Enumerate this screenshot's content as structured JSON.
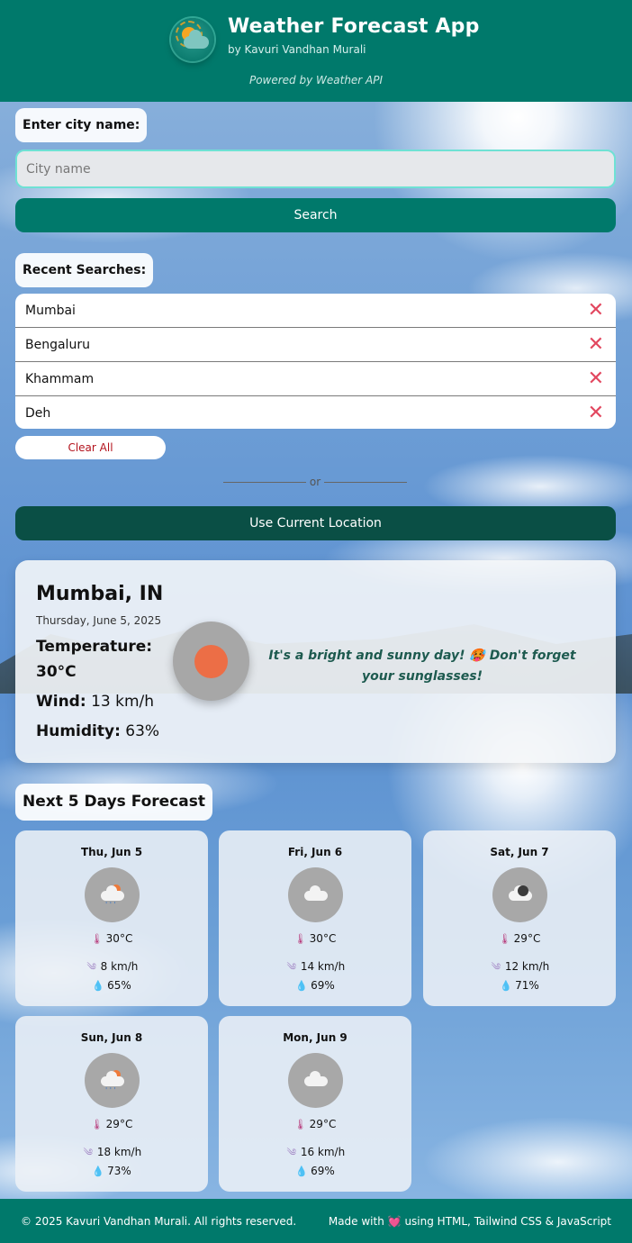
{
  "header": {
    "title": "Weather Forecast App",
    "subtitle": "by Kavuri Vandhan Murali",
    "powered": "Powered by Weather API",
    "logo_icon": "sun-cloud-icon"
  },
  "search": {
    "label": "Enter city name:",
    "placeholder": "City name",
    "value": "",
    "button": "Search"
  },
  "recent": {
    "label": "Recent Searches:",
    "items": [
      "Mumbai",
      "Bengaluru",
      "Khammam",
      "Deh"
    ],
    "remove_symbol": "✕",
    "clear_all": "Clear All"
  },
  "divider": "or",
  "location_button": "Use Current Location",
  "current": {
    "city": "Mumbai, IN",
    "date": "Thursday, June 5, 2025",
    "temperature_label": "Temperature:",
    "temperature": "30°C",
    "wind_label": "Wind:",
    "wind": "13 km/h",
    "humidity_label": "Humidity:",
    "humidity": "63%",
    "icon": "sun-icon",
    "message": "It's a bright and sunny day! 🥵 Don't forget your sunglasses!"
  },
  "forecast": {
    "title": "Next 5 Days Forecast",
    "days": [
      {
        "day": "Thu, Jun 5",
        "icon": "sun-rain-cloud-icon",
        "temp": "30°C",
        "wind": "8 km/h",
        "humidity": "65%"
      },
      {
        "day": "Fri, Jun 6",
        "icon": "cloud-icon",
        "temp": "30°C",
        "wind": "14 km/h",
        "humidity": "69%"
      },
      {
        "day": "Sat, Jun 7",
        "icon": "dark-cloud-icon",
        "temp": "29°C",
        "wind": "12 km/h",
        "humidity": "71%"
      },
      {
        "day": "Sun, Jun 8",
        "icon": "sun-rain-cloud-icon",
        "temp": "29°C",
        "wind": "18 km/h",
        "humidity": "73%"
      },
      {
        "day": "Mon, Jun 9",
        "icon": "cloud-icon",
        "temp": "29°C",
        "wind": "16 km/h",
        "humidity": "69%"
      }
    ]
  },
  "footer": {
    "copyright": "© 2025 Kavuri Vandhan Murali. All rights reserved.",
    "made_with_prefix": "Made with",
    "heart": "💓",
    "made_with_suffix": "using HTML, Tailwind CSS & JavaScript"
  },
  "colors": {
    "primary": "#00796b",
    "dark_button": "#0a4f45",
    "remove": "#e2475f",
    "clear_all_text": "#b3131d",
    "input_border": "#6fe1d4"
  }
}
